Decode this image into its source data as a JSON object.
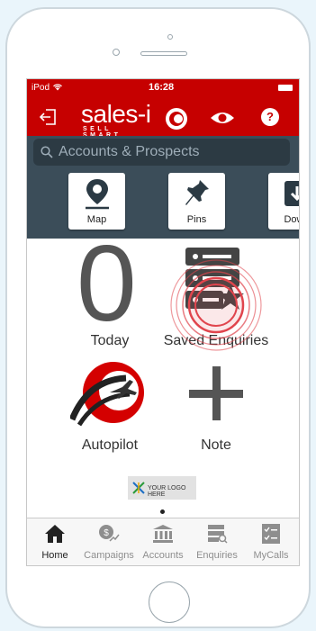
{
  "status": {
    "carrier": "iPod",
    "time": "16:28"
  },
  "header": {
    "brand_name": "sales-i",
    "brand_tagline": "SELL SMART",
    "help_label": "?"
  },
  "search": {
    "placeholder": "Accounts & Prospects"
  },
  "shortcuts": [
    {
      "label": "Map",
      "icon": "map-pin-icon"
    },
    {
      "label": "Pins",
      "icon": "pushpin-icon"
    },
    {
      "label": "Down",
      "icon": "download-icon"
    }
  ],
  "tiles": {
    "today": {
      "count": "0",
      "label": "Today"
    },
    "saved": {
      "label": "Saved Enquiries"
    },
    "autopilot": {
      "label": "Autopilot"
    },
    "note": {
      "label": "Note"
    }
  },
  "logo_placeholder": "YOUR LOGO HERE",
  "tabs": [
    {
      "label": "Home",
      "icon": "home-icon",
      "active": true
    },
    {
      "label": "Campaigns",
      "icon": "campaigns-icon",
      "active": false
    },
    {
      "label": "Accounts",
      "icon": "bank-icon",
      "active": false
    },
    {
      "label": "Enquiries",
      "icon": "enquiries-icon",
      "active": false
    },
    {
      "label": "MyCalls",
      "icon": "checklist-icon",
      "active": false
    }
  ],
  "colors": {
    "brand_red": "#c60000",
    "toolbar_slate": "#3b4d59",
    "tap_ripple": "#e0454d"
  }
}
